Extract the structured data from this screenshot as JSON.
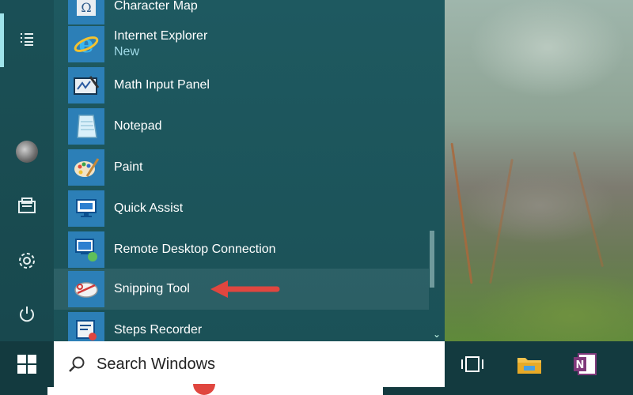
{
  "start_menu": {
    "apps": [
      {
        "name": "Character Map",
        "subtitle": ""
      },
      {
        "name": "Internet Explorer",
        "subtitle": "New"
      },
      {
        "name": "Math Input Panel",
        "subtitle": ""
      },
      {
        "name": "Notepad",
        "subtitle": ""
      },
      {
        "name": "Paint",
        "subtitle": ""
      },
      {
        "name": "Quick Assist",
        "subtitle": ""
      },
      {
        "name": "Remote Desktop Connection",
        "subtitle": ""
      },
      {
        "name": "Snipping Tool",
        "subtitle": ""
      },
      {
        "name": "Steps Recorder",
        "subtitle": ""
      }
    ],
    "rail_icons": [
      "all-apps-list-icon",
      "user-avatar",
      "documents-icon",
      "settings-gear-icon",
      "power-icon"
    ],
    "highlighted_app": "Snipping Tool"
  },
  "taskbar": {
    "search_placeholder": "Search Windows",
    "icons": [
      "windows-start-icon",
      "search-icon",
      "task-view-icon",
      "file-explorer-icon",
      "onenote-icon"
    ]
  },
  "annotation": {
    "arrow_color": "#e0463f",
    "points_to": "Snipping Tool"
  },
  "colors": {
    "accent": "#9fe3ea",
    "tile_blue": "#2c7fb7",
    "menu_bg": "#1e5960",
    "onenote_purple": "#80397b"
  }
}
